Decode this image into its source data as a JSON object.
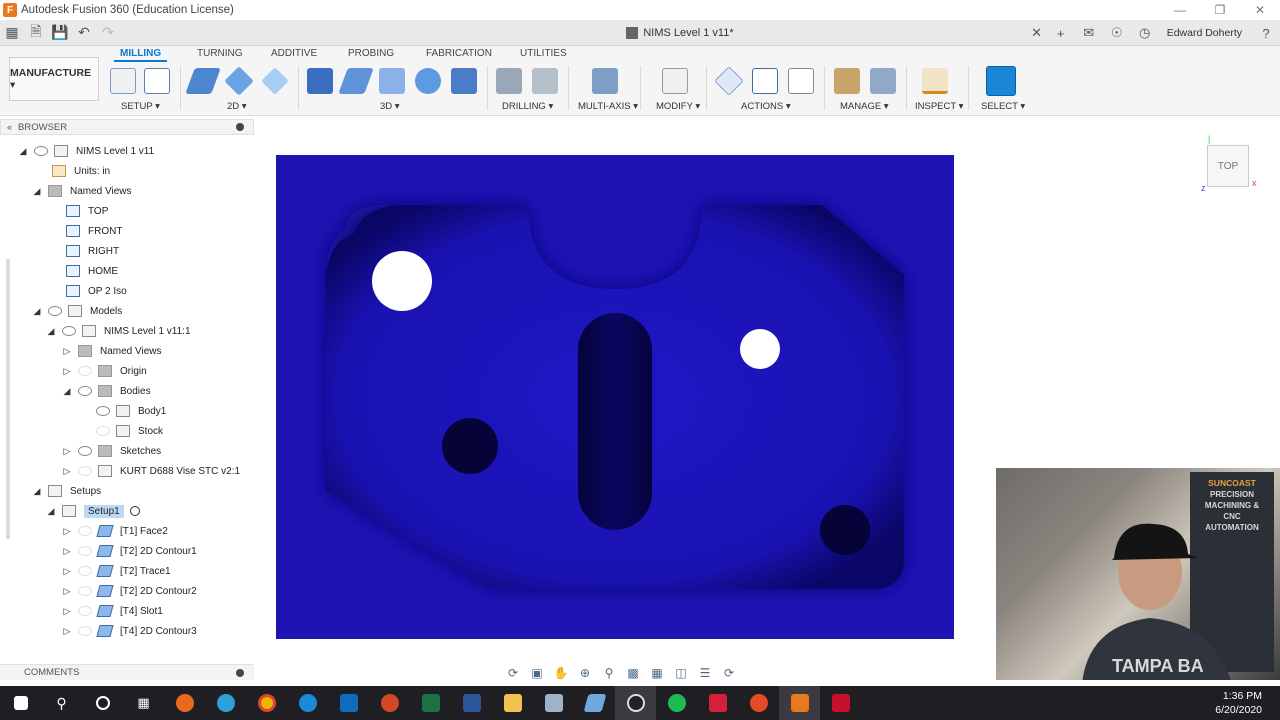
{
  "window": {
    "title": "Autodesk Fusion 360 (Education License)"
  },
  "document": {
    "tab_name": "NIMS Level 1 v11*"
  },
  "user": {
    "name": "Edward Doherty"
  },
  "ribbon": {
    "tabs": [
      "MILLING",
      "TURNING",
      "ADDITIVE",
      "PROBING",
      "FABRICATION",
      "UTILITIES"
    ],
    "active_tab": "MILLING",
    "workspace": "MANUFACTURE ▾",
    "groups": {
      "setup": "SETUP ▾",
      "twod": "2D ▾",
      "threed": "3D ▾",
      "drilling": "DRILLING ▾",
      "multiaxis": "MULTI-AXIS ▾",
      "modify": "MODIFY ▾",
      "actions": "ACTIONS ▾",
      "manage": "MANAGE ▾",
      "inspect": "INSPECT ▾",
      "select": "SELECT ▾"
    }
  },
  "browser": {
    "header": "BROWSER",
    "tree": {
      "root": "NIMS Level 1 v11",
      "units": "Units: in",
      "named_views": "Named Views",
      "views": [
        "TOP",
        "FRONT",
        "RIGHT",
        "HOME",
        "OP 2 Iso"
      ],
      "models": "Models",
      "model_instance": "NIMS Level 1 v11:1",
      "model_named_views": "Named Views",
      "origin": "Origin",
      "bodies": "Bodies",
      "body1": "Body1",
      "stock": "Stock",
      "sketches": "Sketches",
      "vise": "KURT D688 Vise STC v2:1",
      "setups": "Setups",
      "setup1": "Setup1",
      "operations": [
        "[T1] Face2",
        "[T2] 2D Contour1",
        "[T2] Trace1",
        "[T2] 2D Contour2",
        "[T4] Slot1",
        "[T4] 2D Contour3"
      ]
    }
  },
  "viewcube": {
    "label": "TOP"
  },
  "comments": {
    "label": "COMMENTS"
  },
  "webcam": {
    "banner_brand": "SUNCOAST",
    "banner_lines": [
      "PRECISION",
      "MACHINING &",
      "CNC",
      "AUTOMATION"
    ],
    "shirt_text": "TAMPA BA"
  },
  "taskbar": {
    "time": "1:36 PM",
    "date": "6/20/2020"
  },
  "colors": {
    "stock": "#1e14b4",
    "accent": "#0a7ad4"
  }
}
